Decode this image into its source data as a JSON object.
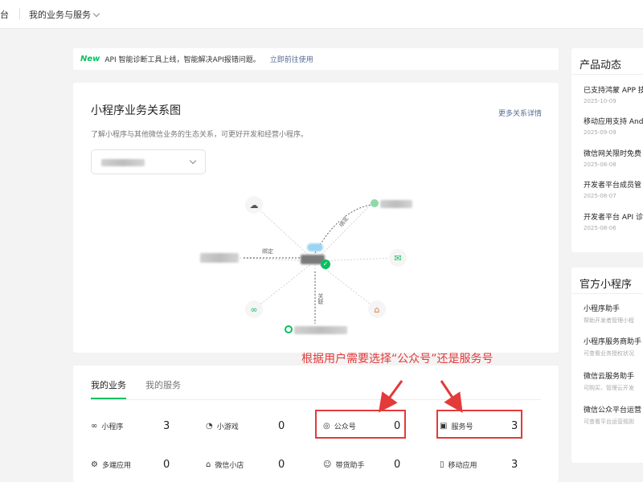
{
  "header": {
    "brand_tail": "台",
    "business_select": "我的业务与服务"
  },
  "notice": {
    "tag": "New",
    "message": "API 智能诊断工具上线，智能解决API报错问题。",
    "link": "立即前往使用"
  },
  "relations": {
    "title": "小程序业务关系图",
    "subtitle": "了解小程序与其他微信业务的生态关系，可更好开发和经营小程序。",
    "more_link": "更多关系详情",
    "edge_labels": [
      "绑定",
      "绑定",
      "关联"
    ]
  },
  "annotation": "根据用户需要选择“公众号”还是服务号",
  "business": {
    "tabs": [
      {
        "label": "我的业务",
        "active": true
      },
      {
        "label": "我的服务",
        "active": false
      }
    ],
    "metrics": [
      {
        "label": "小程序",
        "value": "3",
        "icon": "link-icon"
      },
      {
        "label": "小游戏",
        "value": "0",
        "icon": "game-icon"
      },
      {
        "label": "公众号",
        "value": "0",
        "icon": "official-account-icon"
      },
      {
        "label": "服务号",
        "value": "3",
        "icon": "service-account-icon"
      },
      {
        "label": "多端应用",
        "value": "0",
        "icon": "multi-end-icon"
      },
      {
        "label": "微信小店",
        "value": "0",
        "icon": "shop-icon"
      },
      {
        "label": "带货助手",
        "value": "0",
        "icon": "sales-assistant-icon"
      },
      {
        "label": "移动应用",
        "value": "3",
        "icon": "mobile-app-icon"
      }
    ]
  },
  "news": {
    "title": "产品动态",
    "items": [
      {
        "title": "已支持鸿蒙 APP 技",
        "date": "2025-10-09"
      },
      {
        "title": "移动应用支持 Andr",
        "date": "2025-09-09"
      },
      {
        "title": "微信网关限时免费",
        "date": "2025-08-08"
      },
      {
        "title": "开发者平台成员管",
        "date": "2025-08-07"
      },
      {
        "title": "开发者平台 API 诊",
        "date": "2025-08-06"
      }
    ]
  },
  "mini_programs": {
    "title": "官方小程序",
    "items": [
      {
        "title": "小程序助手",
        "desc": "帮助开发者管理小程"
      },
      {
        "title": "小程序服务商助手",
        "desc": "可查看业务授权状况"
      },
      {
        "title": "微信云服务助手",
        "desc": "可购买、管理云开发"
      },
      {
        "title": "微信公众平台运营",
        "desc": "可查看平台运营规则"
      }
    ]
  },
  "colors": {
    "accent": "#07c160",
    "link": "#576b95",
    "annotation": "#e33a3a"
  }
}
